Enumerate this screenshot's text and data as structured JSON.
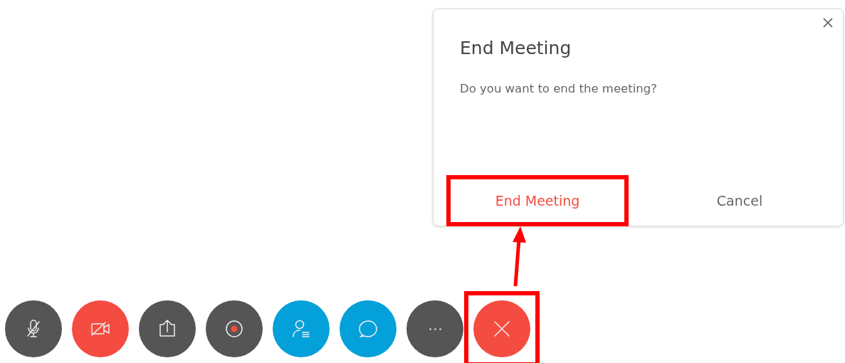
{
  "dialog": {
    "title": "End Meeting",
    "message": "Do you want to end the meeting?",
    "buttons": [
      {
        "label": "End Meeting",
        "kind": "danger",
        "highlighted": true
      },
      {
        "label": "Cancel",
        "kind": "neutral",
        "highlighted": false
      }
    ]
  },
  "toolbar": [
    {
      "kind": "mic-muted",
      "color": "#555555",
      "highlighted": false
    },
    {
      "kind": "video-off",
      "color": "#f44c41",
      "highlighted": false
    },
    {
      "kind": "share",
      "color": "#555555",
      "highlighted": false
    },
    {
      "kind": "record",
      "color": "#555555",
      "highlighted": false
    },
    {
      "kind": "participants",
      "color": "#04a0d9",
      "highlighted": false
    },
    {
      "kind": "chat",
      "color": "#04a0d9",
      "highlighted": false
    },
    {
      "kind": "more",
      "color": "#555555",
      "highlighted": false
    },
    {
      "kind": "end",
      "color": "#f44c41",
      "highlighted": true
    }
  ]
}
